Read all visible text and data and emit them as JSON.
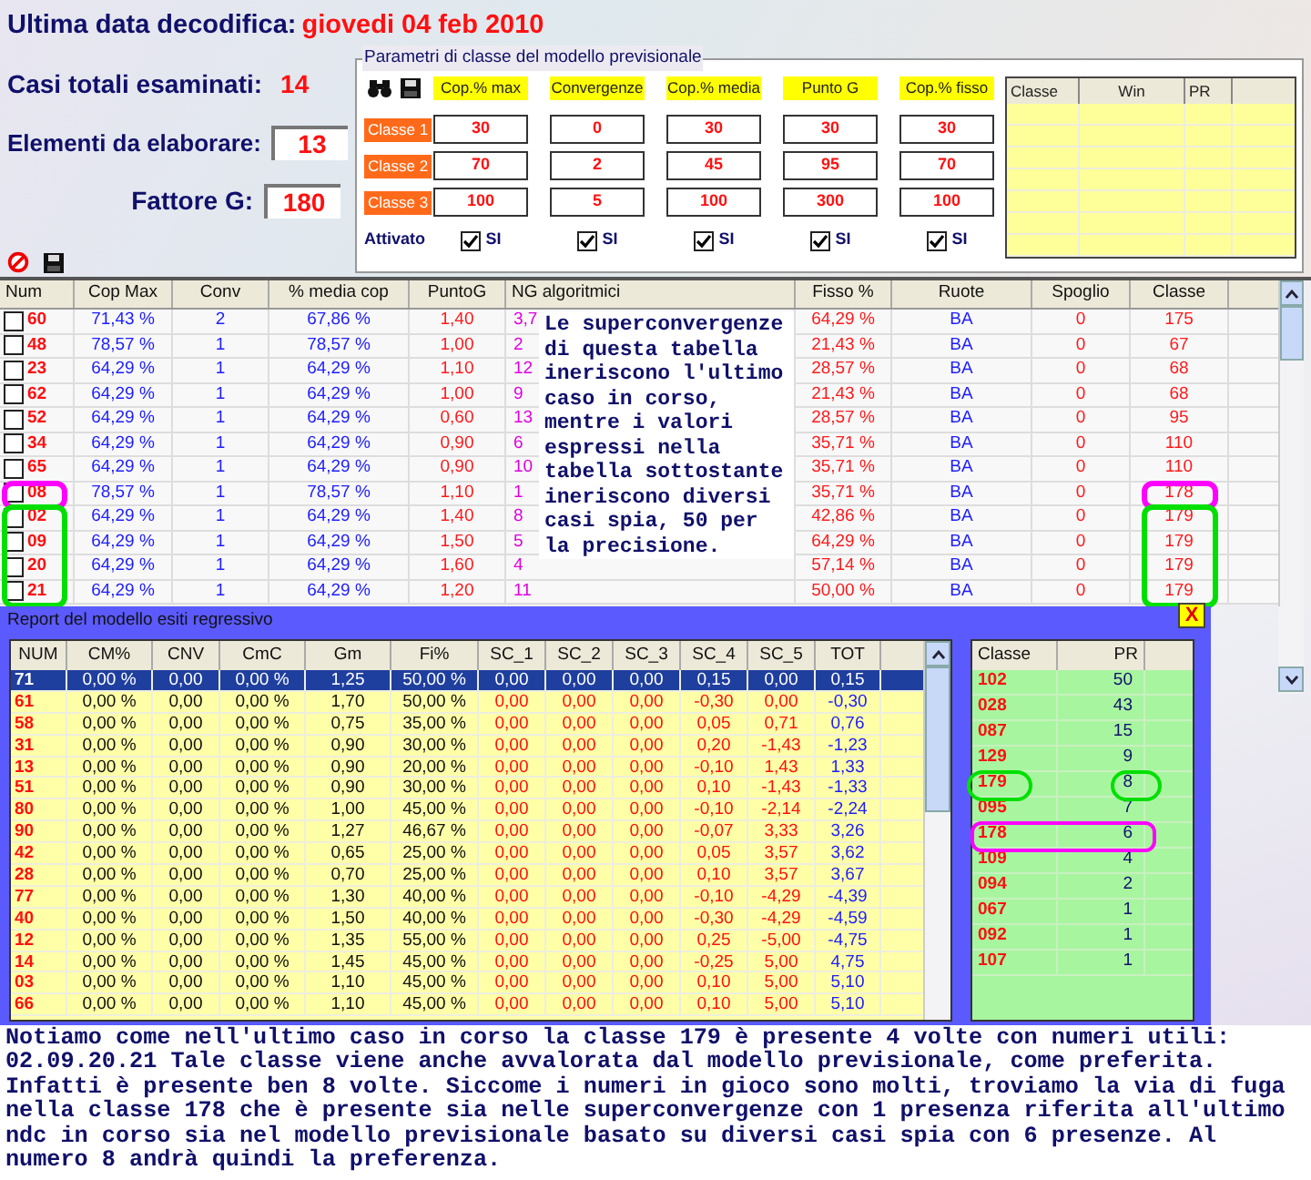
{
  "header": {
    "last_decode_label": "Ultima data decodifica:",
    "last_decode_value": "giovedi 04 feb 2010",
    "cases_label": "Casi totali esaminati:",
    "cases_value": "14",
    "elements_label": "Elementi da elaborare:",
    "elements_value": "13",
    "factor_label": "Fattore G:",
    "factor_value": "180"
  },
  "params": {
    "title": "Parametri di classe del modello previsionale",
    "columns": [
      "Cop.% max",
      "Convergenze",
      "Cop.% media",
      "Punto G",
      "Cop.% fisso"
    ],
    "rows": [
      {
        "label": "Classe 1",
        "values": [
          "30",
          "0",
          "30",
          "30",
          "30"
        ]
      },
      {
        "label": "Classe 2",
        "values": [
          "70",
          "2",
          "45",
          "95",
          "70"
        ]
      },
      {
        "label": "Classe 3",
        "values": [
          "100",
          "5",
          "100",
          "300",
          "100"
        ]
      }
    ],
    "activated_label": "Attivato",
    "activated": [
      {
        "label": "SI",
        "checked": true
      },
      {
        "label": "SI",
        "checked": true
      },
      {
        "label": "SI",
        "checked": true
      },
      {
        "label": "SI",
        "checked": true
      },
      {
        "label": "SI",
        "checked": true
      }
    ],
    "mini_grid": {
      "columns": [
        "Classe",
        "Win",
        "PR"
      ]
    }
  },
  "upper_table": {
    "columns": [
      "Num",
      "Cop Max",
      "Conv",
      "% media cop",
      "PuntoG",
      "NG algoritmici",
      "Fisso %",
      "Ruote",
      "Spoglio",
      "Classe"
    ],
    "rows": [
      {
        "checked": false,
        "cells": [
          "60",
          "71,43 %",
          "2",
          "67,86 %",
          "1,40",
          "3,7",
          "64,29 %",
          "BA",
          "0",
          "175"
        ]
      },
      {
        "checked": false,
        "cells": [
          "48",
          "78,57 %",
          "1",
          "78,57 %",
          "1,00",
          "2",
          "21,43 %",
          "BA",
          "0",
          "67"
        ]
      },
      {
        "checked": false,
        "cells": [
          "23",
          "64,29 %",
          "1",
          "64,29 %",
          "1,10",
          "12",
          "28,57 %",
          "BA",
          "0",
          "68"
        ]
      },
      {
        "checked": false,
        "cells": [
          "62",
          "64,29 %",
          "1",
          "64,29 %",
          "1,00",
          "9",
          "21,43 %",
          "BA",
          "0",
          "68"
        ]
      },
      {
        "checked": false,
        "cells": [
          "52",
          "64,29 %",
          "1",
          "64,29 %",
          "0,60",
          "13",
          "28,57 %",
          "BA",
          "0",
          "95"
        ]
      },
      {
        "checked": false,
        "cells": [
          "34",
          "64,29 %",
          "1",
          "64,29 %",
          "0,90",
          "6",
          "35,71 %",
          "BA",
          "0",
          "110"
        ]
      },
      {
        "checked": false,
        "cells": [
          "65",
          "64,29 %",
          "1",
          "64,29 %",
          "0,90",
          "10",
          "35,71 %",
          "BA",
          "0",
          "110"
        ]
      },
      {
        "checked": false,
        "color": "#ff00ff",
        "cells": [
          "08",
          "78,57 %",
          "1",
          "78,57 %",
          "1,10",
          "1",
          "35,71 %",
          "BA",
          "0",
          "178"
        ]
      },
      {
        "checked": false,
        "color": "#00e000",
        "cells": [
          "02",
          "64,29 %",
          "1",
          "64,29 %",
          "1,40",
          "8",
          "42,86 %",
          "BA",
          "0",
          "179"
        ]
      },
      {
        "checked": false,
        "color": "#00e000",
        "cells": [
          "09",
          "64,29 %",
          "1",
          "64,29 %",
          "1,50",
          "5",
          "64,29 %",
          "BA",
          "0",
          "179"
        ]
      },
      {
        "checked": false,
        "color": "#00e000",
        "cells": [
          "20",
          "64,29 %",
          "1",
          "64,29 %",
          "1,60",
          "4",
          "57,14 %",
          "BA",
          "0",
          "179"
        ]
      },
      {
        "checked": false,
        "color": "#00e000",
        "cells": [
          "21",
          "64,29 %",
          "1",
          "64,29 %",
          "1,20",
          "11",
          "50,00 %",
          "BA",
          "0",
          "179"
        ]
      }
    ],
    "note": "Le superconvergenze di questa tabella ineriscono l'ultimo caso in corso, mentre i valori espressi nella tabella sottostante ineriscono diversi casi spia, 50 per la precisione."
  },
  "report": {
    "title": "Report del modello esiti regressivo",
    "close": "X",
    "columns": [
      "NUM",
      "CM%",
      "CNV",
      "CmC",
      "Gm",
      "Fi%",
      "SC_1",
      "SC_2",
      "SC_3",
      "SC_4",
      "SC_5",
      "TOT"
    ],
    "rows": [
      {
        "selected": true,
        "cells": [
          "71",
          "0,00 %",
          "0,00",
          "0,00 %",
          "1,25",
          "50,00 %",
          "0,00",
          "0,00",
          "0,00",
          "0,15",
          "0,00",
          "0,15"
        ]
      },
      {
        "selected": false,
        "cells": [
          "61",
          "0,00 %",
          "0,00",
          "0,00 %",
          "1,70",
          "50,00 %",
          "0,00",
          "0,00",
          "0,00",
          "-0,30",
          "0,00",
          "-0,30"
        ]
      },
      {
        "selected": false,
        "cells": [
          "58",
          "0,00 %",
          "0,00",
          "0,00 %",
          "0,75",
          "35,00 %",
          "0,00",
          "0,00",
          "0,00",
          "0,05",
          "0,71",
          "0,76"
        ]
      },
      {
        "selected": false,
        "cells": [
          "31",
          "0,00 %",
          "0,00",
          "0,00 %",
          "0,90",
          "30,00 %",
          "0,00",
          "0,00",
          "0,00",
          "0,20",
          "-1,43",
          "-1,23"
        ]
      },
      {
        "selected": false,
        "cells": [
          "13",
          "0,00 %",
          "0,00",
          "0,00 %",
          "0,90",
          "20,00 %",
          "0,00",
          "0,00",
          "0,00",
          "-0,10",
          "1,43",
          "1,33"
        ]
      },
      {
        "selected": false,
        "cells": [
          "51",
          "0,00 %",
          "0,00",
          "0,00 %",
          "0,90",
          "30,00 %",
          "0,00",
          "0,00",
          "0,00",
          "0,10",
          "-1,43",
          "-1,33"
        ]
      },
      {
        "selected": false,
        "cells": [
          "80",
          "0,00 %",
          "0,00",
          "0,00 %",
          "1,00",
          "45,00 %",
          "0,00",
          "0,00",
          "0,00",
          "-0,10",
          "-2,14",
          "-2,24"
        ]
      },
      {
        "selected": false,
        "cells": [
          "90",
          "0,00 %",
          "0,00",
          "0,00 %",
          "1,27",
          "46,67 %",
          "0,00",
          "0,00",
          "0,00",
          "-0,07",
          "3,33",
          "3,26"
        ]
      },
      {
        "selected": false,
        "cells": [
          "42",
          "0,00 %",
          "0,00",
          "0,00 %",
          "0,65",
          "25,00 %",
          "0,00",
          "0,00",
          "0,00",
          "0,05",
          "3,57",
          "3,62"
        ]
      },
      {
        "selected": false,
        "cells": [
          "28",
          "0,00 %",
          "0,00",
          "0,00 %",
          "0,70",
          "25,00 %",
          "0,00",
          "0,00",
          "0,00",
          "0,10",
          "3,57",
          "3,67"
        ]
      },
      {
        "selected": false,
        "cells": [
          "77",
          "0,00 %",
          "0,00",
          "0,00 %",
          "1,30",
          "40,00 %",
          "0,00",
          "0,00",
          "0,00",
          "-0,10",
          "-4,29",
          "-4,39"
        ]
      },
      {
        "selected": false,
        "cells": [
          "40",
          "0,00 %",
          "0,00",
          "0,00 %",
          "1,50",
          "40,00 %",
          "0,00",
          "0,00",
          "0,00",
          "-0,30",
          "-4,29",
          "-4,59"
        ]
      },
      {
        "selected": false,
        "cells": [
          "12",
          "0,00 %",
          "0,00",
          "0,00 %",
          "1,35",
          "55,00 %",
          "0,00",
          "0,00",
          "0,00",
          "0,25",
          "-5,00",
          "-4,75"
        ]
      },
      {
        "selected": false,
        "cells": [
          "14",
          "0,00 %",
          "0,00",
          "0,00 %",
          "1,45",
          "45,00 %",
          "0,00",
          "0,00",
          "0,00",
          "-0,25",
          "5,00",
          "4,75"
        ]
      },
      {
        "selected": false,
        "cells": [
          "03",
          "0,00 %",
          "0,00",
          "0,00 %",
          "1,10",
          "45,00 %",
          "0,00",
          "0,00",
          "0,00",
          "0,10",
          "5,00",
          "5,10"
        ]
      },
      {
        "selected": false,
        "cells": [
          "66",
          "0,00 %",
          "0,00",
          "0,00 %",
          "1,10",
          "45,00 %",
          "0,00",
          "0,00",
          "0,00",
          "0,10",
          "5,00",
          "5,10"
        ]
      }
    ],
    "class_table": {
      "columns": [
        "Classe",
        "PR"
      ],
      "rows": [
        {
          "cells": [
            "102",
            "50"
          ]
        },
        {
          "cells": [
            "028",
            "43"
          ]
        },
        {
          "cells": [
            "087",
            "15"
          ]
        },
        {
          "cells": [
            "129",
            "9"
          ]
        },
        {
          "cells": [
            "179",
            "8"
          ],
          "color": "#00e000",
          "kind": "cells"
        },
        {
          "cells": [
            "095",
            "7"
          ]
        },
        {
          "cells": [
            "178",
            "6"
          ],
          "color": "#ff00ff",
          "kind": "row"
        },
        {
          "cells": [
            "109",
            "4"
          ]
        },
        {
          "cells": [
            "094",
            "2"
          ]
        },
        {
          "cells": [
            "067",
            "1"
          ]
        },
        {
          "cells": [
            "092",
            "1"
          ]
        },
        {
          "cells": [
            "107",
            "1"
          ]
        }
      ]
    }
  },
  "comment": "Notiamo come nell'ultimo caso in corso la classe 179 è presente 4 volte con numeri utili: 02.09.20.21 Tale classe viene anche avvalorata dal modello previsionale, come preferita. Infatti è presente ben 8 volte. Siccome i numeri in gioco sono molti, troviamo la via di fuga nella classe 178 che è presente sia nelle superconvergenze con 1 presenza riferita all'ultimo ndc in corso sia nel modello previsionale basato su diversi casi spia con 6 presenze. Al numero 8 andrà quindi la preferenza."
}
